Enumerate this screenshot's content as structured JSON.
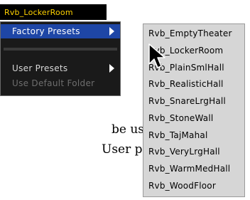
{
  "popup": {
    "title": "Rvb_LockerRoom"
  },
  "main_menu": {
    "items": [
      {
        "label": "Factory Presets",
        "state": "highlighted",
        "submenu": true
      },
      {
        "label": "User Presets",
        "state": "normal",
        "submenu": true
      },
      {
        "label": "Use Default Folder",
        "state": "disabled",
        "submenu": false
      }
    ]
  },
  "submenu": {
    "items": [
      "Rvb_EmptyTheater",
      "Rvb_LockerRoom",
      "Rvb_PlainSmlHall",
      "Rvb_RealisticHall",
      "Rvb_SnareLrgHall",
      "Rvb_StoneWall",
      "Rvb_TajMahal",
      "Rvb_VeryLrgHall",
      "Rvb_WarmMedHall",
      "Rvb_WoodFloor"
    ]
  },
  "document": {
    "line1": "be used as a",
    "line2": "User presets."
  },
  "colors": {
    "popup_bg": "#000000",
    "popup_text": "#ffd200",
    "menu_bg": "#1a1a1a",
    "highlight": "#1e46a6",
    "submenu_bg": "#d6d6d6"
  },
  "icons": {
    "pointer": "arrow-cursor-icon",
    "submenu_arrow": "triangle-right-icon"
  }
}
